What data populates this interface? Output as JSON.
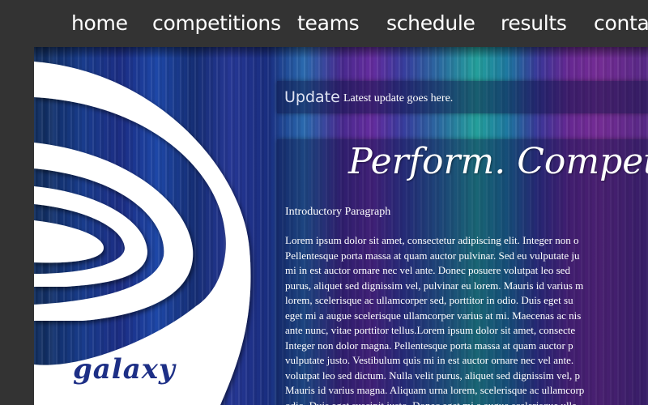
{
  "nav": {
    "items": [
      {
        "label": "home"
      },
      {
        "label": "competitions"
      },
      {
        "label": "teams"
      },
      {
        "label": "schedule"
      },
      {
        "label": "results"
      },
      {
        "label": "conta"
      }
    ]
  },
  "logo": {
    "text": "galaxy"
  },
  "update": {
    "title": "Update",
    "text": "Latest update goes here."
  },
  "content": {
    "tagline": "Perform. Compete. Ex",
    "intro_heading": "Introductory Paragraph",
    "lines": [
      "Lorem ipsum dolor sit amet, consectetur adipiscing elit. Integer non o",
      "Pellentesque porta massa at quam auctor pulvinar. Sed eu vulputate ju",
      "mi in est auctor ornare nec vel ante. Donec posuere volutpat leo sed",
      "purus, aliquet sed dignissim vel, pulvinar eu lorem. Mauris id varius m",
      "lorem, scelerisque ac ullamcorper sed, porttitor in odio. Duis eget su",
      "eget mi a augue scelerisque ullamcorper varius at mi. Maecenas ac nis",
      "ante nunc, vitae porttitor tellus.Lorem ipsum dolor sit amet, consecte",
      "Integer non dolor magna. Pellentesque porta massa at quam auctor p",
      "vulputate justo. Vestibulum quis mi in est auctor ornare nec vel ante.",
      "volutpat leo sed dictum. Nulla velit purus, aliquet sed dignissim vel, p",
      "Mauris id varius magna. Aliquam urna lorem, scelerisque ac ullamcorp",
      "odio. Duis eget suscipit justo. Donec eget mi a augue scelerisque ulla"
    ]
  }
}
